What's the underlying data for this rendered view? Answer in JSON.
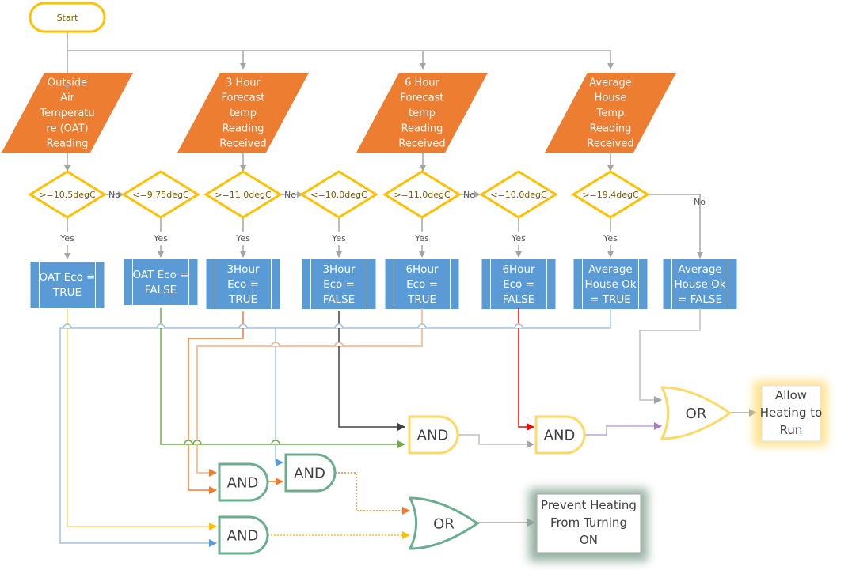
{
  "start": {
    "label": "Start"
  },
  "inputs": [
    {
      "id": "oat",
      "lines": [
        "Outside",
        "Air",
        "Temperatu",
        "re (OAT)",
        "Reading"
      ]
    },
    {
      "id": "h3",
      "lines": [
        "3 Hour",
        "Forecast",
        "temp",
        "Reading",
        "Received"
      ]
    },
    {
      "id": "h6",
      "lines": [
        "6 Hour",
        "Forecast",
        "temp",
        "Reading",
        "Received"
      ]
    },
    {
      "id": "avg",
      "lines": [
        "Average",
        "House",
        "Temp",
        "Reading",
        "Received"
      ]
    }
  ],
  "decisions": [
    {
      "id": "d1",
      "label": ">=10.5degC"
    },
    {
      "id": "d2",
      "label": "<=9.75degC"
    },
    {
      "id": "d3",
      "label": ">=11.0degC"
    },
    {
      "id": "d4",
      "label": "<=10.0degC"
    },
    {
      "id": "d5",
      "label": ">=11.0degC"
    },
    {
      "id": "d6",
      "label": "<=10.0degC"
    },
    {
      "id": "d7",
      "label": ">=19.4degC"
    }
  ],
  "branch_labels": {
    "yes": "Yes",
    "no": "No"
  },
  "processes": [
    {
      "id": "p1",
      "lines": [
        "OAT Eco =",
        "TRUE"
      ]
    },
    {
      "id": "p2",
      "lines": [
        "OAT Eco =",
        "FALSE"
      ]
    },
    {
      "id": "p3",
      "lines": [
        "3Hour",
        "Eco =",
        "TRUE"
      ]
    },
    {
      "id": "p4",
      "lines": [
        "3Hour",
        "Eco =",
        "FALSE"
      ]
    },
    {
      "id": "p5",
      "lines": [
        "6Hour",
        "Eco =",
        "TRUE"
      ]
    },
    {
      "id": "p6",
      "lines": [
        "6Hour",
        "Eco =",
        "FALSE"
      ]
    },
    {
      "id": "p7",
      "lines": [
        "Average",
        "House Ok",
        "= TRUE"
      ]
    },
    {
      "id": "p8",
      "lines": [
        "Average",
        "House Ok",
        "= FALSE"
      ]
    }
  ],
  "gates": {
    "and_label": "AND",
    "or_label": "OR"
  },
  "outputs": {
    "allow": {
      "lines": [
        "Allow",
        "Heating to",
        "Run"
      ]
    },
    "prevent": {
      "lines": [
        "Prevent Heating",
        "From Turning",
        "ON"
      ]
    }
  },
  "colors": {
    "input_fill": "#ED7D31",
    "decision_stroke": "#FFC000",
    "process_fill": "#5B9BD5",
    "connector": "#A5A5A5",
    "gate_yellow": "#FFD966",
    "gate_green": "#6BAE8E",
    "wire_yellow": "#FFC000",
    "wire_blue": "#5B9BD5",
    "wire_green": "#70AD47",
    "wire_orange": "#ED7D31",
    "wire_light_orange": "#F4B183",
    "wire_dark": "#404040",
    "wire_red": "#FF0000",
    "wire_purple": "#A77BC1"
  }
}
